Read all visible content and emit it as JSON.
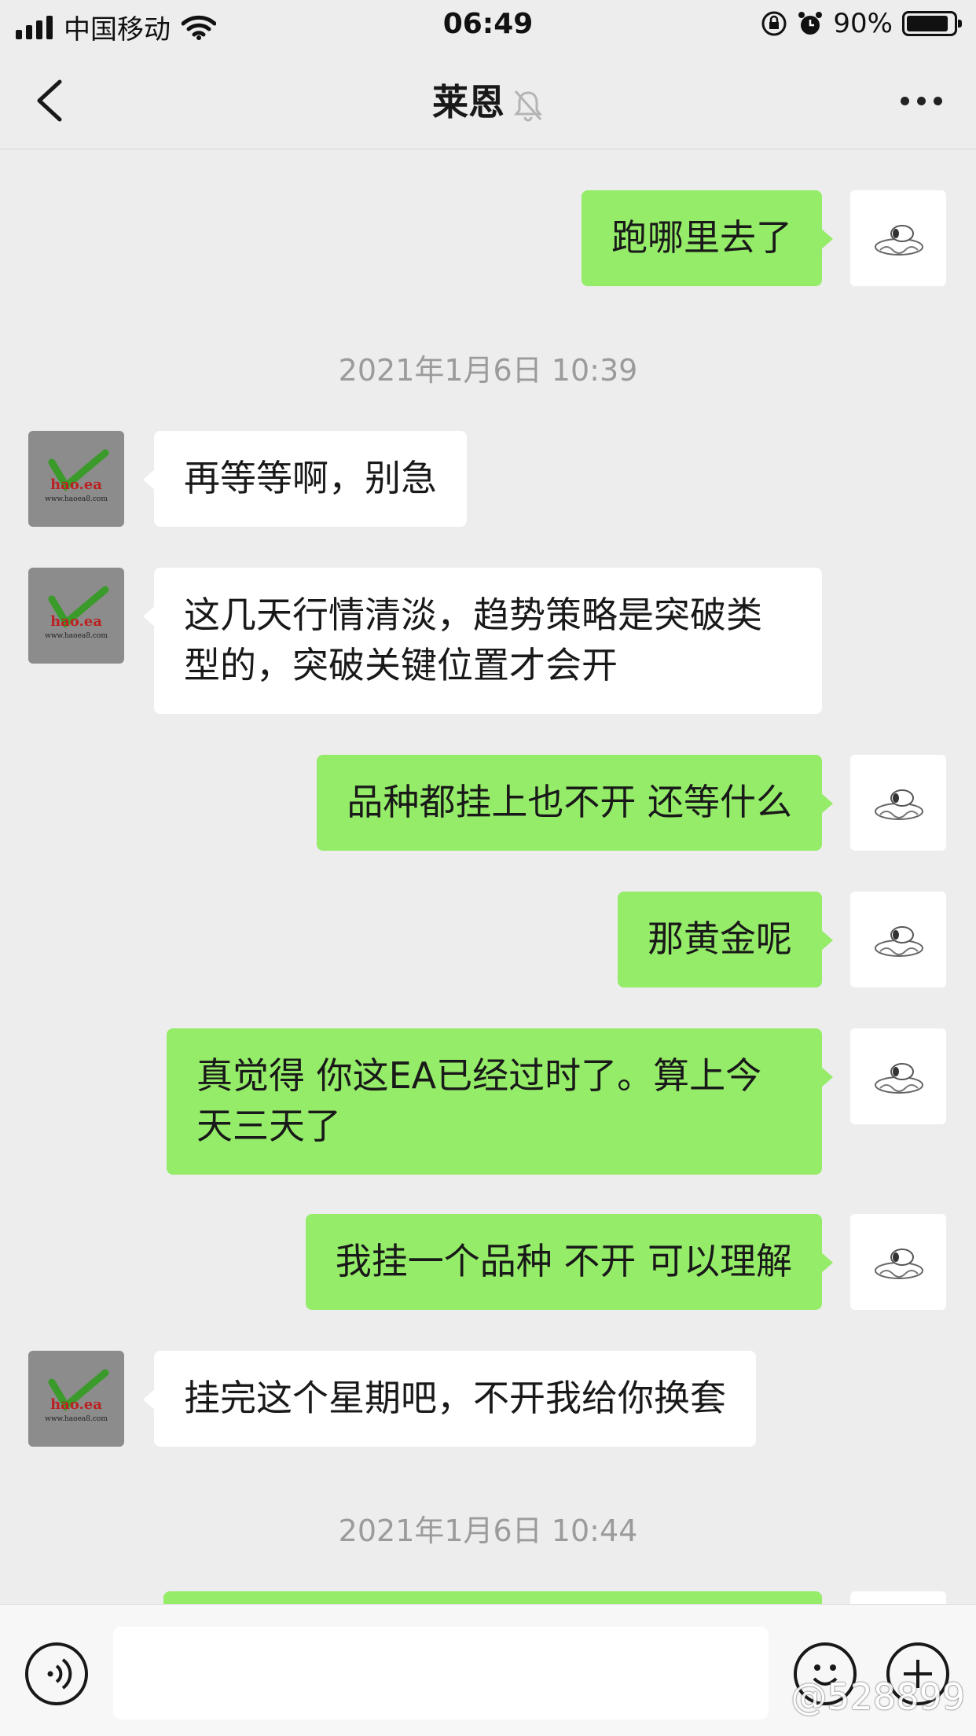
{
  "status_bar": {
    "carrier": "中国移动",
    "time": "06:49",
    "battery": "90%",
    "battery_level": 0.9
  },
  "nav": {
    "title": "莱恩"
  },
  "avatar": {
    "other_logo_text": "hao.ea",
    "other_logo_url": "www.haoea8.com"
  },
  "messages": [
    {
      "sender": "self",
      "text": "跑哪里去了"
    },
    {
      "timestamp": "2021年1月6日 10:39"
    },
    {
      "sender": "other",
      "text": "再等等啊，别急"
    },
    {
      "sender": "other",
      "text": "这几天行情清淡，趋势策略是突破类型的，突破关键位置才会开"
    },
    {
      "sender": "self",
      "text": "品种都挂上也不开 还等什么"
    },
    {
      "sender": "self",
      "text": "那黄金呢"
    },
    {
      "sender": "self",
      "text": "真觉得 你这EA已经过时了。算上今天三天了"
    },
    {
      "sender": "self",
      "text": "我挂一个品种 不开 可以理解"
    },
    {
      "sender": "other",
      "text": "挂完这个星期吧，不开我给你换套"
    },
    {
      "timestamp": "2021年1月6日 10:44"
    }
  ],
  "watermark": "@528899"
}
